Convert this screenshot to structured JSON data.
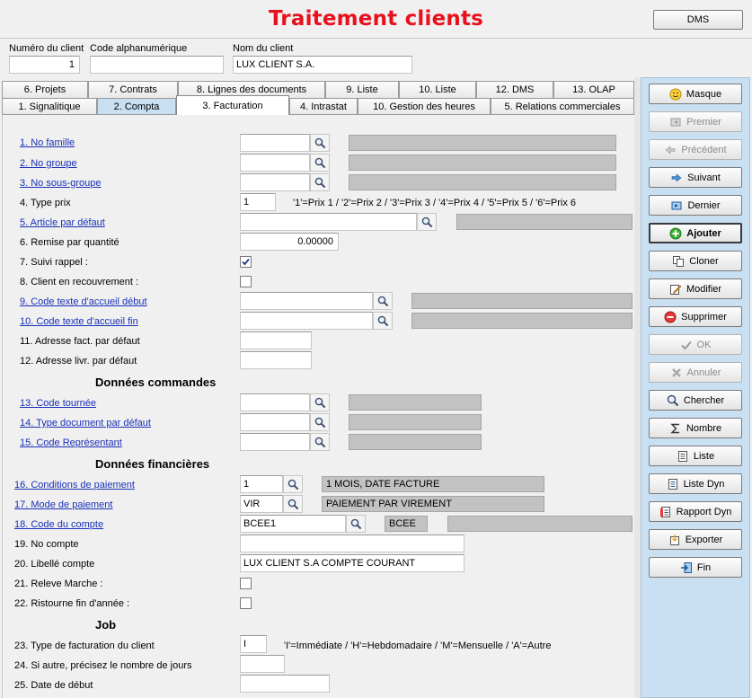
{
  "header": {
    "title": "Traitement clients",
    "dms_button": "DMS"
  },
  "client": {
    "numero_label": "Numéro du client",
    "numero_value": "1",
    "code_label": "Code alphanumérique",
    "code_value": "",
    "nom_label": "Nom du client",
    "nom_value": "LUX CLIENT S.A."
  },
  "tabs_row1": [
    "6. Projets",
    "7. Contrats",
    "8. Lignes des documents",
    "9. Liste",
    "10. Liste",
    "12. DMS",
    "13. OLAP"
  ],
  "tabs_row2": [
    "1. Signalitique",
    "2. Compta",
    "3. Facturation",
    "4. Intrastat",
    "10. Gestion des heures",
    "5. Relations commerciales"
  ],
  "form": {
    "no_famille": "1. No famille",
    "no_groupe": "2. No groupe",
    "no_sous_groupe": "3. No sous-groupe",
    "type_prix": "4. Type prix",
    "type_prix_value": "1",
    "type_prix_hint": "'1'=Prix 1 / '2'=Prix 2 / '3'=Prix 3 / '4'=Prix 4 / '5'=Prix 5 / '6'=Prix 6",
    "article_defaut": "5. Article par défaut",
    "remise": "6. Remise par quantité",
    "remise_value": "0.00000",
    "suivi_rappel": "7. Suivi rappel :",
    "recouvrement": "8. Client en recouvrement :",
    "texte_debut": "9. Code texte d'accueil début",
    "texte_fin": "10. Code texte d'accueil fin",
    "adr_fact": "11. Adresse fact. par défaut",
    "adr_livr": "12. Adresse livr. par défaut",
    "sect_commandes": "Données commandes",
    "tournee": "13. Code tournée",
    "type_doc": "14. Type document par défaut",
    "representant": "15. Code Représentant",
    "sect_financieres": "Données financières",
    "conditions": "16. Conditions de paiement",
    "conditions_value": "1",
    "conditions_desc": "1 MOIS, DATE FACTURE",
    "mode": "17. Mode de paiement",
    "mode_value": "VIR",
    "mode_desc": "PAIEMENT PAR VIREMENT",
    "code_compte": "18. Code du compte",
    "code_compte_value": "BCEE1",
    "code_compte_bank": "BCEE",
    "no_compte": "19. No compte",
    "libelle": "20. Libellé compte",
    "libelle_value": "LUX CLIENT S.A COMPTE COURANT",
    "releve": "21. Releve Marche :",
    "ristourne": "22. Ristourne fin d'année :",
    "sect_job": "Job",
    "type_fact": "23. Type de facturation du client",
    "type_fact_value": "I",
    "type_fact_hint": "'I'=Immédiate / 'H'=Hebdomadaire / 'M'=Mensuelle / 'A'=Autre",
    "autre_jours": "24. Si autre, précisez le nombre de jours",
    "date_debut": "25. Date de début"
  },
  "actions": {
    "masque": "Masque",
    "premier": "Premier",
    "precedent": "Précédent",
    "suivant": "Suivant",
    "dernier": "Dernier",
    "ajouter": "Ajouter",
    "cloner": "Cloner",
    "modifier": "Modifier",
    "supprimer": "Supprimer",
    "ok": "OK",
    "annuler": "Annuler",
    "chercher": "Chercher",
    "nombre": "Nombre",
    "liste": "Liste",
    "liste_dyn": "Liste Dyn",
    "rapport_dyn": "Rapport Dyn",
    "exporter": "Exporter",
    "fin": "Fin"
  }
}
